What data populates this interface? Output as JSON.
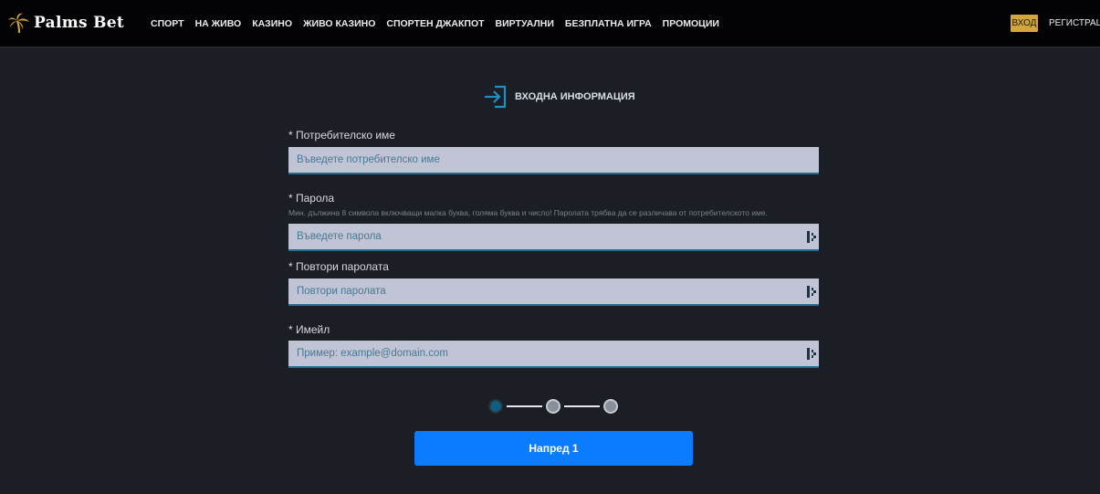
{
  "brand": {
    "logo_text": "Palms Bet",
    "accent_color": "#d4a63a",
    "primary_color": "#0a7cff"
  },
  "header": {
    "nav": [
      {
        "label": "СПОРТ"
      },
      {
        "label": "НА ЖИВО"
      },
      {
        "label": "КАЗИНО"
      },
      {
        "label": "ЖИВО КАЗИНО"
      },
      {
        "label": "СПОРТЕН ДЖАКПОТ"
      },
      {
        "label": "ВИРТУАЛНИ"
      },
      {
        "label": "БЕЗПЛАТНА ИГРА"
      },
      {
        "label": "ПРОМОЦИИ"
      }
    ],
    "login_label": "ВХОД",
    "register_label": "РЕГИСТРАЦИЯ"
  },
  "form": {
    "section_title": "ВХОДНА ИНФОРМАЦИЯ",
    "section_icon": "sign-in-icon",
    "username": {
      "label": "* Потребителско име",
      "placeholder": "Въведете потребителско име",
      "value": ""
    },
    "password": {
      "label": "* Парола",
      "hint": "Мин. дължина 8 символа включващи малка буква, голяма буква и число! Паролата трябва да се различава от потребителското име.",
      "placeholder": "Въведете парола",
      "value": ""
    },
    "password_repeat": {
      "label": "* Повтори паролата",
      "placeholder": "Повтори паролата",
      "value": ""
    },
    "email": {
      "label": "* Имейл",
      "placeholder": "Пример: example@domain.com",
      "value": ""
    },
    "steps": {
      "total": 3,
      "current": 1
    },
    "next_label": "Напред 1"
  }
}
